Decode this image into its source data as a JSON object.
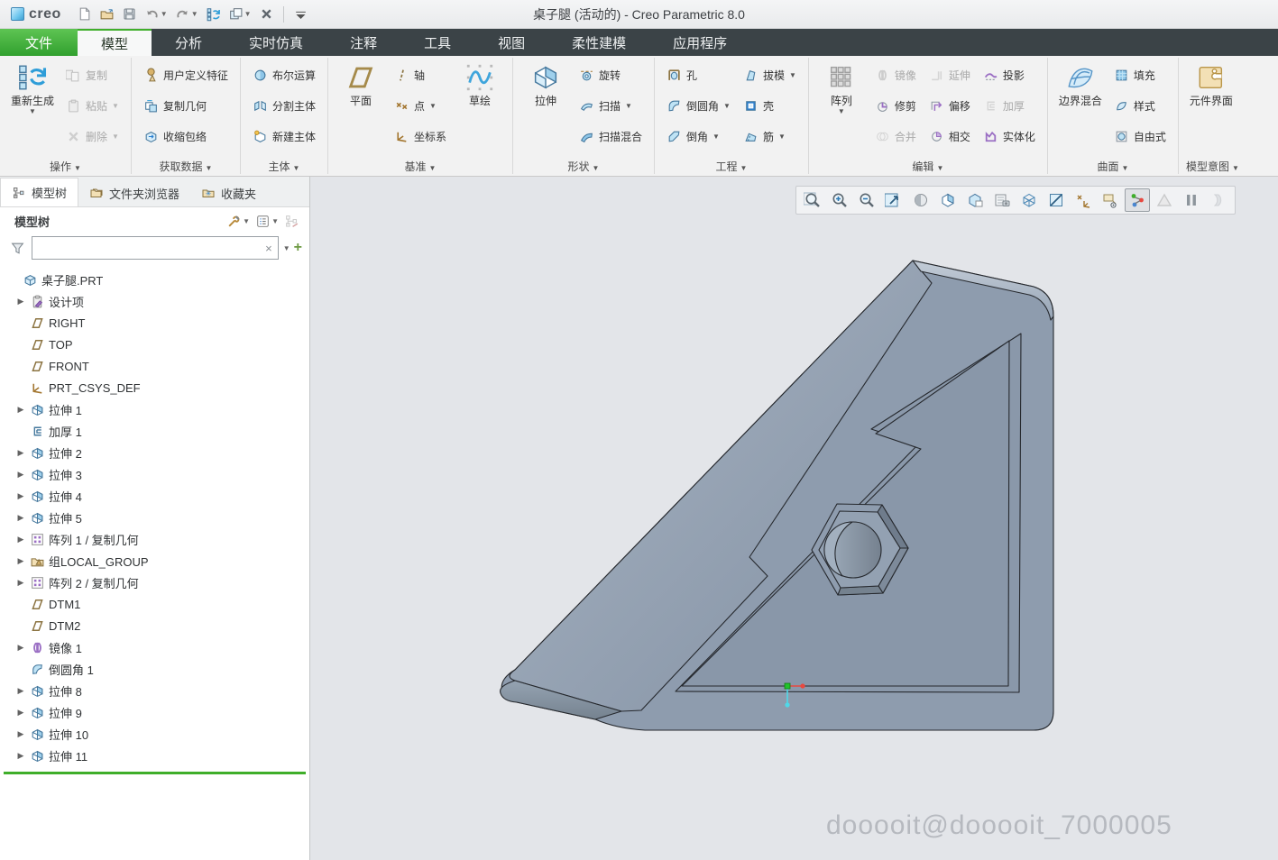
{
  "titlebar": {
    "logo_text": "creo",
    "title": "桌子腿 (活动的) - Creo Parametric 8.0",
    "qat": [
      {
        "name": "new-file-button",
        "icon": "new-doc"
      },
      {
        "name": "open-button",
        "icon": "open-folder"
      },
      {
        "name": "save-button",
        "icon": "save"
      },
      {
        "name": "undo-button",
        "icon": "undo",
        "arrow": true
      },
      {
        "name": "redo-button",
        "icon": "redo",
        "arrow": true
      },
      {
        "name": "regenerate-quick-button",
        "icon": "regen-small"
      },
      {
        "name": "windows-button",
        "icon": "windows",
        "arrow": true
      },
      {
        "name": "close-window-button",
        "icon": "close-x"
      },
      {
        "name": "separator",
        "sep": true
      },
      {
        "name": "customize-qat-button",
        "icon": "drop-only"
      }
    ]
  },
  "tabs": [
    {
      "label": "文件",
      "style": "file"
    },
    {
      "label": "模型",
      "style": "active"
    },
    {
      "label": "分析"
    },
    {
      "label": "实时仿真"
    },
    {
      "label": "注释"
    },
    {
      "label": "工具"
    },
    {
      "label": "视图"
    },
    {
      "label": "柔性建模"
    },
    {
      "label": "应用程序"
    }
  ],
  "ribbon": {
    "groups": [
      {
        "label": "操作",
        "blocks": [
          {
            "type": "big",
            "label": "重新生成",
            "icon": "regenerate",
            "arrow": true
          },
          {
            "type": "col",
            "items": [
              {
                "label": "复制",
                "icon": "copy",
                "disabled": true
              },
              {
                "label": "粘贴",
                "icon": "paste",
                "disabled": true,
                "arrow": true
              },
              {
                "label": "删除",
                "icon": "delete",
                "disabled": true,
                "arrow": true
              }
            ]
          }
        ]
      },
      {
        "label": "获取数据",
        "blocks": [
          {
            "type": "col",
            "items": [
              {
                "label": "用户定义特征",
                "icon": "udf"
              },
              {
                "label": "复制几何",
                "icon": "copy-geometry"
              },
              {
                "label": "收缩包络",
                "icon": "shrinkwrap"
              }
            ]
          }
        ]
      },
      {
        "label": "主体",
        "blocks": [
          {
            "type": "col",
            "items": [
              {
                "label": "布尔运算",
                "icon": "boolean"
              },
              {
                "label": "分割主体",
                "icon": "split-body"
              },
              {
                "label": "新建主体",
                "icon": "new-body"
              }
            ]
          }
        ]
      },
      {
        "label": "基准",
        "blocks": [
          {
            "type": "big",
            "label": "平面",
            "icon": "plane-big"
          },
          {
            "type": "col",
            "items": [
              {
                "label": "轴",
                "icon": "axis"
              },
              {
                "label": "点",
                "icon": "point",
                "arrow": true
              },
              {
                "label": "坐标系",
                "icon": "csys"
              }
            ]
          },
          {
            "type": "big",
            "label": "草绘",
            "icon": "sketch-big"
          }
        ]
      },
      {
        "label": "形状",
        "blocks": [
          {
            "type": "big",
            "label": "拉伸",
            "icon": "extrude-big"
          },
          {
            "type": "col",
            "items": [
              {
                "label": "旋转",
                "icon": "revolve"
              },
              {
                "label": "扫描",
                "icon": "sweep",
                "arrow": true
              },
              {
                "label": "扫描混合",
                "icon": "sweep-blend"
              }
            ]
          }
        ]
      },
      {
        "label": "工程",
        "blocks": [
          {
            "type": "col",
            "items": [
              {
                "label": "孔",
                "icon": "hole"
              },
              {
                "label": "倒圆角",
                "icon": "round",
                "arrow": true
              },
              {
                "label": "倒角",
                "icon": "chamfer",
                "arrow": true
              }
            ]
          },
          {
            "type": "col",
            "items": [
              {
                "label": "拔模",
                "icon": "draft",
                "arrow": true
              },
              {
                "label": "壳",
                "icon": "shell"
              },
              {
                "label": "筋",
                "icon": "rib",
                "arrow": true
              }
            ]
          }
        ]
      },
      {
        "label": "编辑",
        "blocks": [
          {
            "type": "big",
            "label": "阵列",
            "icon": "pattern-big",
            "arrow": true
          },
          {
            "type": "col",
            "items": [
              {
                "label": "镜像",
                "icon": "mirror",
                "disabled": true
              },
              {
                "label": "修剪",
                "icon": "trim"
              },
              {
                "label": "合并",
                "icon": "merge",
                "disabled": true
              }
            ]
          },
          {
            "type": "col",
            "items": [
              {
                "label": "延伸",
                "icon": "extend",
                "disabled": true
              },
              {
                "label": "偏移",
                "icon": "offset"
              },
              {
                "label": "相交",
                "icon": "intersect"
              }
            ]
          },
          {
            "type": "col",
            "items": [
              {
                "label": "投影",
                "icon": "project"
              },
              {
                "label": "加厚",
                "icon": "thicken",
                "disabled": true
              },
              {
                "label": "实体化",
                "icon": "solidify"
              }
            ]
          }
        ]
      },
      {
        "label": "曲面",
        "blocks": [
          {
            "type": "big",
            "label": "边界混合",
            "icon": "boundary-blend-big"
          },
          {
            "type": "col",
            "items": [
              {
                "label": "填充",
                "icon": "fill"
              },
              {
                "label": "样式",
                "icon": "style"
              },
              {
                "label": "自由式",
                "icon": "freestyle"
              }
            ]
          }
        ]
      },
      {
        "label": "模型意图",
        "blocks": [
          {
            "type": "big",
            "label": "元件界面",
            "icon": "component-interface-big"
          }
        ]
      }
    ]
  },
  "tree": {
    "tabs": [
      {
        "label": "模型树",
        "icon": "model-tree",
        "active": true
      },
      {
        "label": "文件夹浏览器",
        "icon": "folder-browser"
      },
      {
        "label": "收藏夹",
        "icon": "favorites"
      }
    ],
    "header": {
      "title": "模型树"
    },
    "filter": {
      "value": "",
      "placeholder": ""
    },
    "items": [
      {
        "label": "桌子腿.PRT",
        "icon": "part"
      },
      {
        "label": "设计项",
        "icon": "design-items",
        "expand": true
      },
      {
        "label": "RIGHT",
        "icon": "datum-plane"
      },
      {
        "label": "TOP",
        "icon": "datum-plane"
      },
      {
        "label": "FRONT",
        "icon": "datum-plane"
      },
      {
        "label": "PRT_CSYS_DEF",
        "icon": "csys-feat"
      },
      {
        "label": "拉伸 1",
        "icon": "extrude-feat",
        "expand": true
      },
      {
        "label": "加厚 1",
        "icon": "thicken-feat"
      },
      {
        "label": "拉伸 2",
        "icon": "extrude-feat",
        "expand": true
      },
      {
        "label": "拉伸 3",
        "icon": "extrude-feat",
        "expand": true
      },
      {
        "label": "拉伸 4",
        "icon": "extrude-feat",
        "expand": true
      },
      {
        "label": "拉伸 5",
        "icon": "extrude-feat",
        "expand": true
      },
      {
        "label": "阵列 1 / 复制几何",
        "icon": "pattern-feat",
        "expand": true
      },
      {
        "label": "组LOCAL_GROUP",
        "icon": "group-feat",
        "expand": true
      },
      {
        "label": "阵列 2 / 复制几何",
        "icon": "pattern-feat",
        "expand": true
      },
      {
        "label": "DTM1",
        "icon": "datum-plane"
      },
      {
        "label": "DTM2",
        "icon": "datum-plane"
      },
      {
        "label": "镜像 1",
        "icon": "mirror-feat",
        "expand": true
      },
      {
        "label": "倒圆角 1",
        "icon": "round-feat"
      },
      {
        "label": "拉伸 8",
        "icon": "extrude-feat",
        "expand": true
      },
      {
        "label": "拉伸 9",
        "icon": "extrude-feat",
        "expand": true
      },
      {
        "label": "拉伸 10",
        "icon": "extrude-feat",
        "expand": true
      },
      {
        "label": "拉伸 11",
        "icon": "extrude-feat",
        "expand": true
      }
    ]
  },
  "canvas": {
    "toolbar": [
      {
        "name": "zoom-window"
      },
      {
        "name": "zoom-in"
      },
      {
        "name": "zoom-out"
      },
      {
        "name": "refit"
      },
      {
        "name": "shading-style"
      },
      {
        "name": "display-style"
      },
      {
        "name": "saved-orientations"
      },
      {
        "name": "view-manager"
      },
      {
        "name": "perspective"
      },
      {
        "name": "section"
      },
      {
        "name": "datum-display"
      },
      {
        "name": "annotation-display"
      },
      {
        "name": "spin-center",
        "active": true
      },
      {
        "name": "geometry-check",
        "disabled": true
      },
      {
        "name": "pause"
      },
      {
        "name": "resume",
        "disabled": true
      }
    ],
    "watermark": "dooooit@dooooit_7000005",
    "model_colors": {
      "face": "#8e9cae",
      "edge": "#26292e",
      "pocket": "#8997a9",
      "accent_green": "#22c32a",
      "accent_red": "#e8483f",
      "accent_cyan": "#4fd8e8"
    }
  }
}
